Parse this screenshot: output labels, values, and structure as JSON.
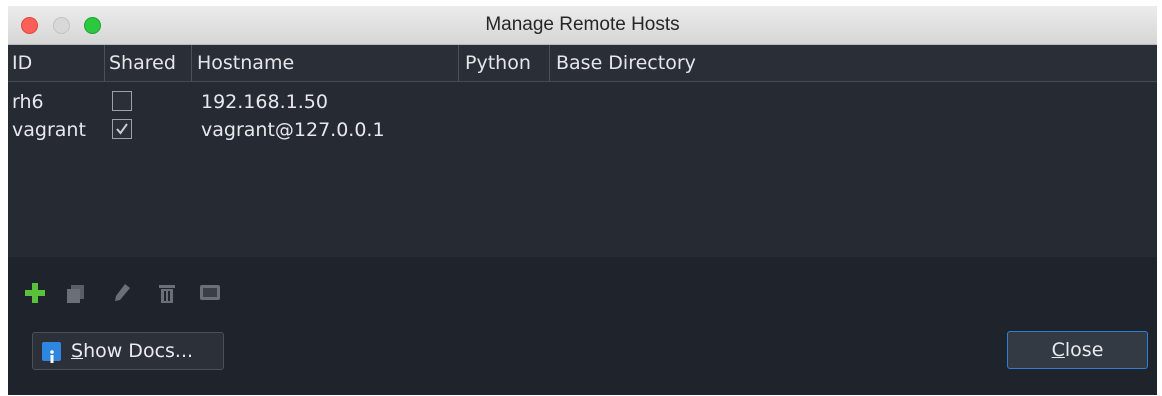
{
  "window": {
    "title": "Manage Remote Hosts"
  },
  "table": {
    "columns": [
      {
        "key": "id",
        "label": "ID"
      },
      {
        "key": "shared",
        "label": "Shared"
      },
      {
        "key": "hostname",
        "label": "Hostname"
      },
      {
        "key": "python",
        "label": "Python"
      },
      {
        "key": "base_directory",
        "label": "Base Directory"
      }
    ],
    "rows": [
      {
        "id": "rh6",
        "shared": false,
        "hostname": "192.168.1.50",
        "python": "",
        "base_directory": ""
      },
      {
        "id": "vagrant",
        "shared": true,
        "hostname": "vagrant@127.0.0.1",
        "python": "",
        "base_directory": ""
      }
    ]
  },
  "toolbar": {
    "icons": [
      "add-icon",
      "duplicate-icon",
      "edit-icon",
      "delete-icon",
      "terminal-icon"
    ]
  },
  "buttons": {
    "show_docs": {
      "mnemonic": "S",
      "rest": "how Docs..."
    },
    "close": {
      "mnemonic": "C",
      "rest": "lose"
    }
  },
  "colors": {
    "accent": "#2f7fd6",
    "add": "#59c13c",
    "background": "#1f232b"
  }
}
